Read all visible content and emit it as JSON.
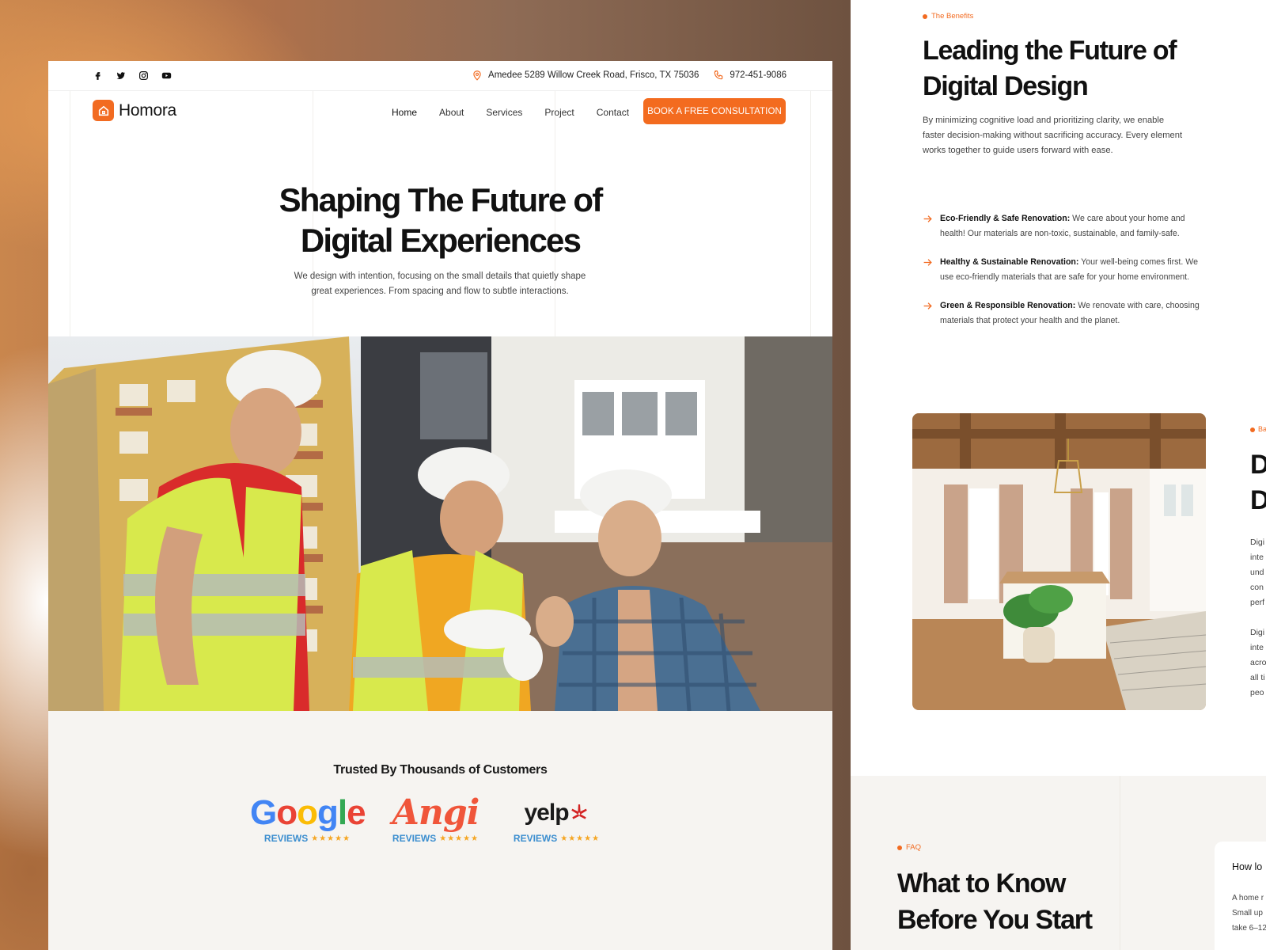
{
  "topbar": {
    "socials": [
      "facebook-icon",
      "twitter-icon",
      "instagram-icon",
      "youtube-icon"
    ],
    "address": "Amedee 5289 Willow Creek Road, Frisco, TX 75036",
    "phone": "972-451-9086"
  },
  "nav": {
    "brand": "Homora",
    "items": [
      "Home",
      "About",
      "Services",
      "Project",
      "Contact"
    ],
    "active": "Home",
    "cta": "BOOK A FREE CONSULTATION"
  },
  "hero": {
    "title_line1": "Shaping The Future of",
    "title_line2": "Digital Experiences",
    "subtitle_line1": "We design with intention, focusing on the small details that quietly shape",
    "subtitle_line2": "great experiences. From spacing and flow to subtle interactions."
  },
  "trusted": {
    "title": "Trusted By Thousands of Customers",
    "brands": [
      {
        "name": "Google",
        "label": "REVIEWS",
        "stars": "★★★★★"
      },
      {
        "name": "Angi",
        "label": "REVIEWS",
        "stars": "★★★★★"
      },
      {
        "name": "yelp",
        "label": "REVIEWS",
        "stars": "★★★★★"
      }
    ]
  },
  "benefits_section": {
    "tag": "The Benefits",
    "title_line1": "Leading the Future of",
    "title_line2": "Digital Design",
    "desc_line1": "By minimizing cognitive load and prioritizing clarity, we enable",
    "desc_line2": "faster decision-making without sacrificing accuracy. Every element",
    "desc_line3": "works together to guide users forward with ease.",
    "items": [
      {
        "title": "Eco-Friendly & Safe Renovation:",
        "text_line1": " We care about your home and",
        "text_line2": "health! Our materials are non-toxic, sustainable, and family-safe."
      },
      {
        "title": "Healthy & Sustainable Renovation:",
        "text_line1": " Your well-being comes first. We",
        "text_line2": "use eco-friendly materials that are safe for your home environment."
      },
      {
        "title": "Green & Responsible Renovation:",
        "text_line1": " We renovate with care, choosing",
        "text_line2": "materials that protect your health and the planet."
      }
    ]
  },
  "peek": {
    "tag": "Ba",
    "big_line1": "D",
    "big_line2": "D",
    "body": [
      "Digi",
      "inte",
      "und",
      "con",
      "perf",
      "",
      "Digi",
      "inte",
      "acro",
      "all ti",
      "peo"
    ]
  },
  "faq": {
    "tag": "FAQ",
    "title_line1": "What to Know",
    "title_line2": "Before You Start",
    "question": "How lo",
    "answer": [
      "A home r",
      "Small up",
      "take 6–12"
    ]
  },
  "colors": {
    "accent": "#f36b1f",
    "band": "#f6f4f1"
  }
}
